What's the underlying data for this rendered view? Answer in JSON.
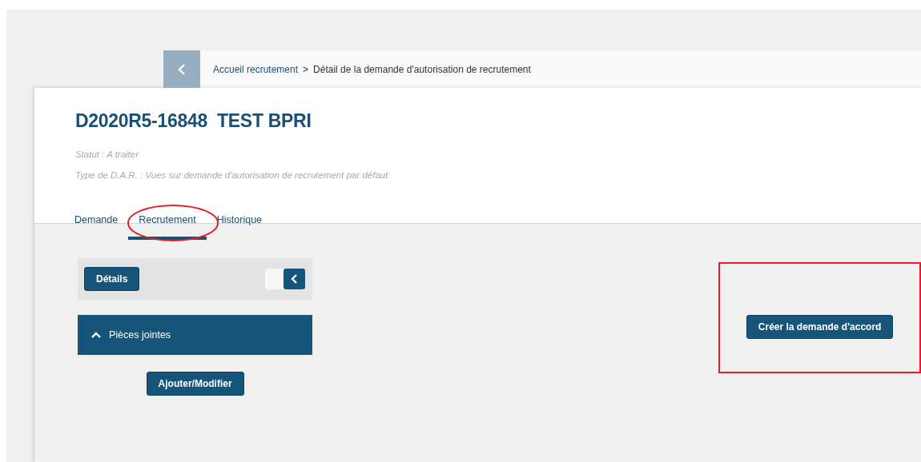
{
  "breadcrumb": {
    "items": [
      "Accueil recrutement",
      "Détail de la demande d'autorisation de recrutement"
    ],
    "separator": ">"
  },
  "header": {
    "title": "D2020R5-16848  TEST BPRI",
    "status": "Statut : A traiter",
    "type": "Type de D.A.R. : Vues sur demande d'autorisation de recrutement par défaut"
  },
  "tabs": [
    {
      "label": "Demande",
      "selected": false
    },
    {
      "label": "Recrutement",
      "selected": true
    },
    {
      "label": "Historique",
      "selected": false
    }
  ],
  "details_panel": {
    "button": "Détails",
    "collapsed": false
  },
  "attachments": {
    "title": "Pièces jointes",
    "expanded": true,
    "button": "Ajouter/Modifier"
  },
  "action_button": "Créer la demande d'accord",
  "tab_highlight": {
    "kind": "ellipse"
  },
  "button_highlight": {
    "kind": "rectangle"
  }
}
